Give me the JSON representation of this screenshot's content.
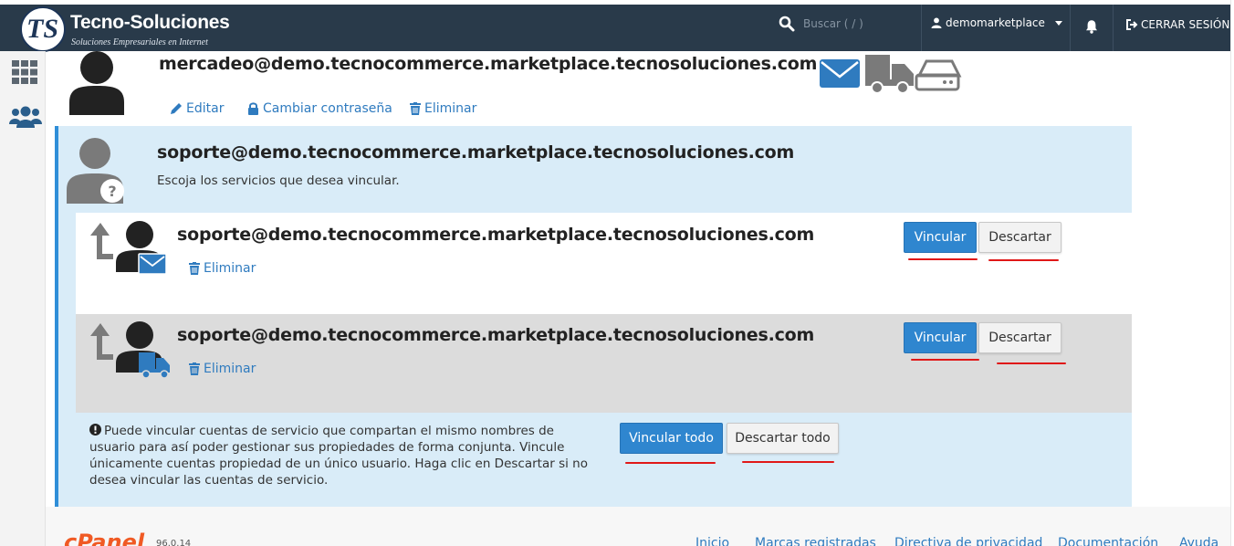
{
  "header": {
    "brand_name": "Tecno-Soluciones",
    "brand_tagline": "Soluciones Empresariales en Internet",
    "logo_letters": "TS",
    "search_placeholder": "Buscar ( / )",
    "username": "demomarketplace",
    "logout_label": "CERRAR SESIÓN",
    "bg_color": "#293a4a"
  },
  "sidebar": {
    "items": [
      {
        "icon": "grid-icon"
      },
      {
        "icon": "users-icon"
      }
    ]
  },
  "main_account": {
    "email": "mercadeo@demo.tecnocommerce.marketplace.tecnosoluciones.com",
    "actions": {
      "edit": "Editar",
      "change_password": "Cambiar contraseña",
      "delete": "Eliminar"
    },
    "services": [
      "email-icon",
      "truck-icon",
      "hard-drive-icon"
    ]
  },
  "link_panel": {
    "email": "soporte@demo.tecnocommerce.marketplace.tecnosoluciones.com",
    "instruction": "Escoja los servicios que desea vincular.",
    "accent_color": "#2f8ed8",
    "bg_color": "#d9ecf8",
    "services": [
      {
        "email": "soporte@demo.tecnocommerce.marketplace.tecnosoluciones.com",
        "service_icon": "email-icon",
        "delete_label": "Eliminar",
        "link_label": "Vincular",
        "dismiss_label": "Descartar"
      },
      {
        "email": "soporte@demo.tecnocommerce.marketplace.tecnosoluciones.com",
        "service_icon": "truck-icon",
        "delete_label": "Eliminar",
        "link_label": "Vincular",
        "dismiss_label": "Descartar"
      }
    ],
    "note": "Puede vincular cuentas de servicio que compartan el mismo nombres de usuario para así poder gestionar sus propiedades de forma conjunta. Vincule únicamente cuentas propiedad de un único usuario. Haga clic en Descartar si no desea vincular las cuentas de servicio.",
    "link_all_label": "Vincular todo",
    "dismiss_all_label": "Descartar todo"
  },
  "footer": {
    "brand": "cPanel",
    "version": "96.0.14",
    "links": [
      "Inicio",
      "Marcas registradas",
      "Directiva de privacidad",
      "Documentación",
      "Ayuda"
    ]
  },
  "colors": {
    "primary": "#2f86cf",
    "link": "#2f7bbf",
    "annotation_red": "#e01818",
    "cpanel_orange": "#f05a24"
  }
}
